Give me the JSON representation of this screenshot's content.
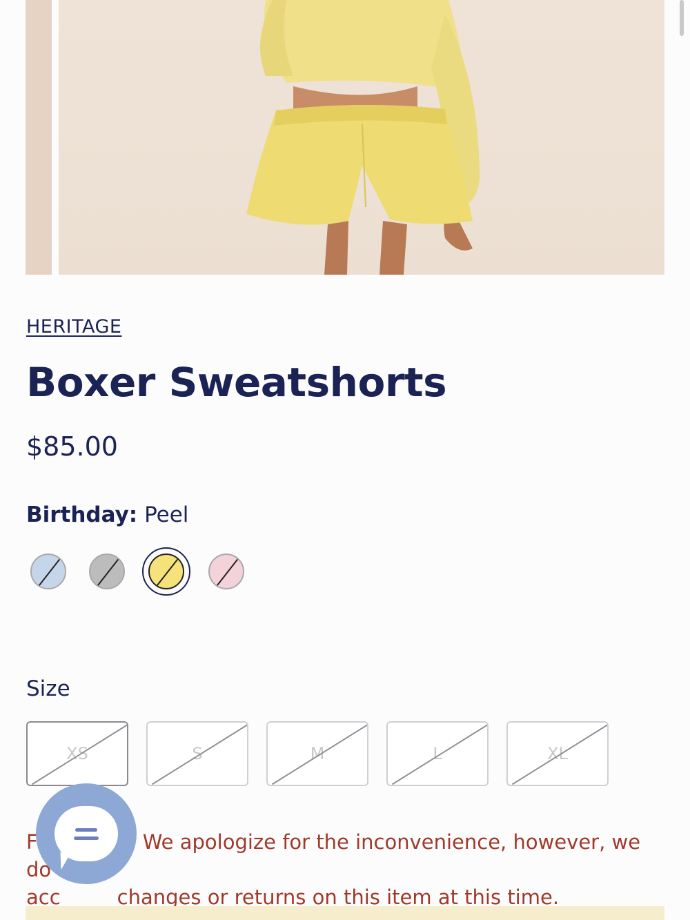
{
  "product": {
    "brand": "HERITAGE",
    "title": "Boxer Sweatshorts",
    "price": "$85.00"
  },
  "color": {
    "group_label": "Birthday:",
    "selected_name": "Peel",
    "swatches": [
      {
        "color": "#c6d6ea",
        "available": false
      },
      {
        "color": "#bcbcbc",
        "available": false
      },
      {
        "color": "#f5e27a",
        "available": false,
        "selected": true
      },
      {
        "color": "#f3d2da",
        "available": false
      }
    ]
  },
  "size": {
    "label": "Size",
    "options": [
      "XS",
      "S",
      "M",
      "L",
      "XL"
    ]
  },
  "notice": {
    "line1_start": "F",
    "line1_end": "We apologize for the inconvenience, however, we do not",
    "line2_start": "acc",
    "line2_end": "changes or returns on this item at this time."
  },
  "colors": {
    "navy": "#1a2354",
    "notice_red": "#a0392b",
    "chat_blue": "#8ea8d6"
  },
  "icons": {
    "chat": "chat-bubble-icon"
  }
}
